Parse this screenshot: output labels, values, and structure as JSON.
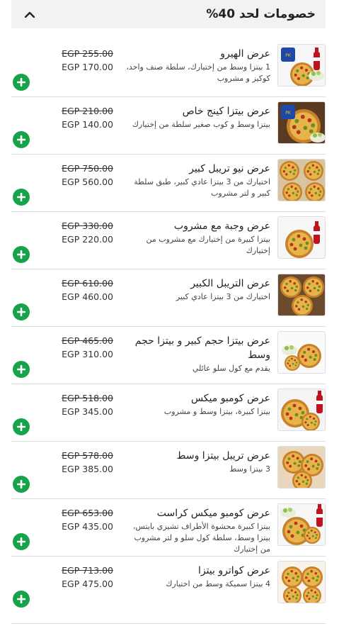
{
  "header": {
    "title": "خصومات لحد 40%"
  },
  "offers": [
    {
      "name": "عرض الهيرو",
      "desc": "1 بيتزا وسط من إختيارك، سلطة صنف واحد، كوكيز و مشروب",
      "old": "EGP 255.00",
      "new": "EGP 170.00"
    },
    {
      "name": "عرض بيتزا كينج خاص",
      "desc": "بيتزا وسط و كوب صغير سلطة من إختيارك",
      "old": "EGP 210.00",
      "new": "EGP 140.00"
    },
    {
      "name": "عرض نيو تريبل كبير",
      "desc": "اختيارك من 3 بيتزا عادي كبير، طبق سلطة كبير و لتر مشروب",
      "old": "EGP 750.00",
      "new": "EGP 560.00"
    },
    {
      "name": "عرض وجبة مع مشروب",
      "desc": "بيتزا كبيرة من إختيارك مع مشروب من إختيارك",
      "old": "EGP 330.00",
      "new": "EGP 220.00"
    },
    {
      "name": "عرض التريبل الكبير",
      "desc": "اختيارك من 3 بيتزا عادي كبير",
      "old": "EGP 610.00",
      "new": "EGP 460.00"
    },
    {
      "name": "عرض بيتزا حجم كبير و بيتزا حجم وسط",
      "desc": "يقدم مع كول سلو عائلي",
      "old": "EGP 465.00",
      "new": "EGP 310.00"
    },
    {
      "name": "عرض كومبو ميكس",
      "desc": "بيتزا كبيرة، بيتزا وسط و مشروب",
      "old": "EGP 518.00",
      "new": "EGP 345.00"
    },
    {
      "name": "عرض تريبل بيتزا وسط",
      "desc": "3 بيتزا وسط",
      "old": "EGP 578.00",
      "new": "EGP 385.00"
    },
    {
      "name": "عرض كومبو ميكس كراست",
      "desc": "بيتزا كبيرة محشوة الأطراف تشيزي بايتس، بيتزا وسط، سلطة كول سلو و لتر مشروب من إختيارك",
      "old": "EGP 653.00",
      "new": "EGP 435.00"
    },
    {
      "name": "عرض كواترو بيتزا",
      "desc": "4 بيتزا سميكة وسط من اختيارك",
      "old": "EGP 713.00",
      "new": "EGP 475.00"
    }
  ],
  "icons": {
    "chevron": "chevron-up-icon",
    "add": "plus-circle-icon"
  },
  "colors": {
    "accent": "#16a34a",
    "header_bg": "#f2f2f2"
  }
}
